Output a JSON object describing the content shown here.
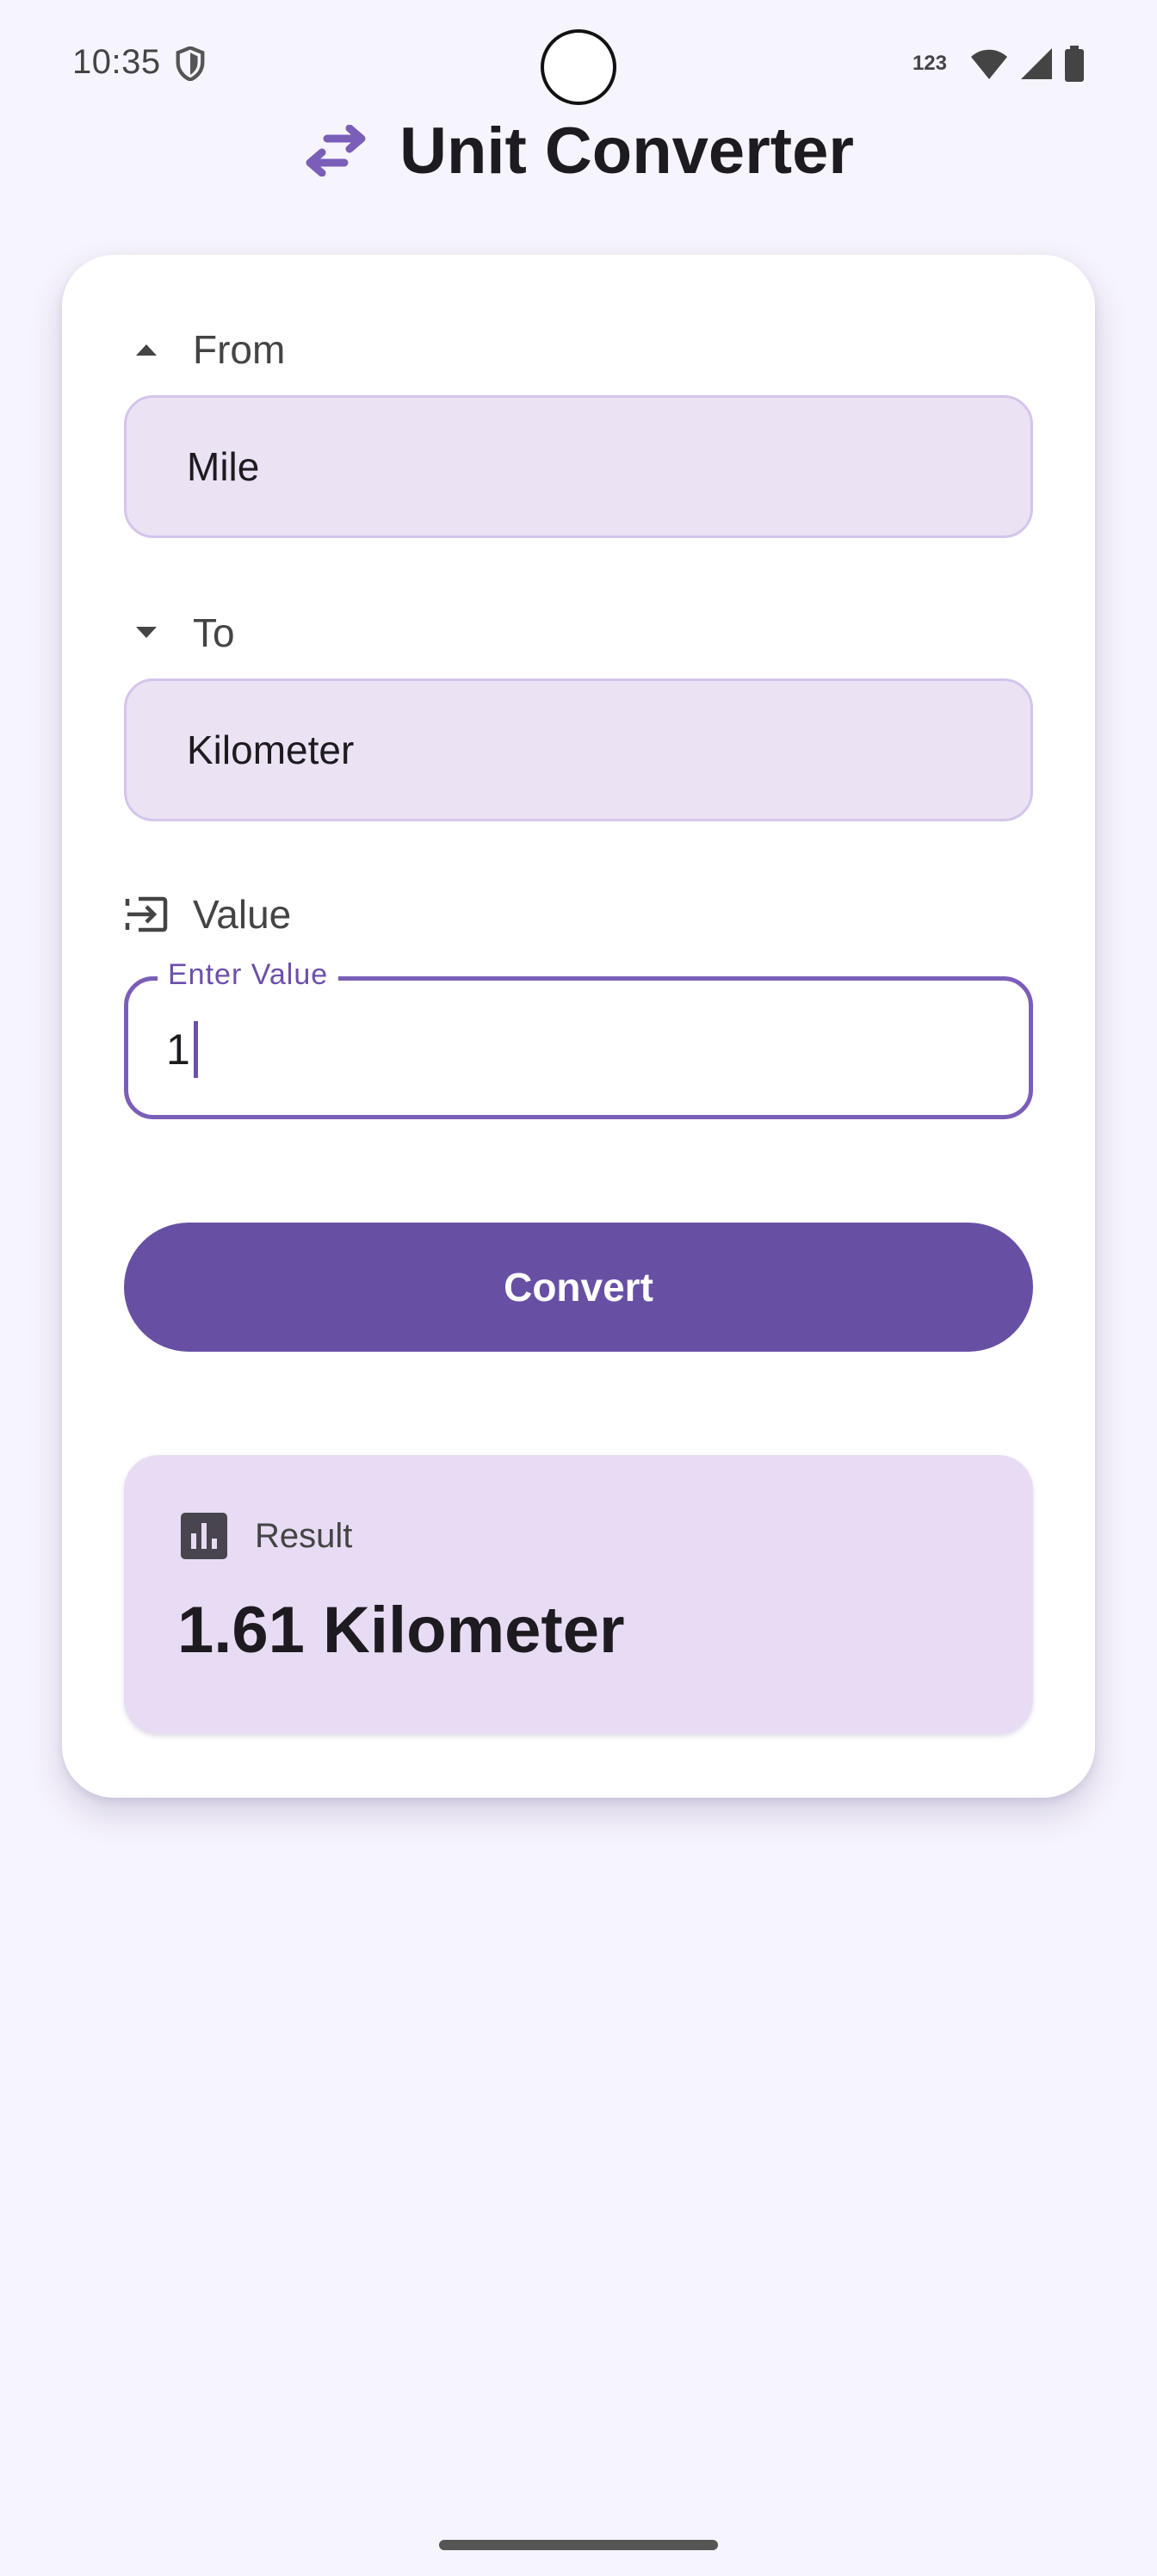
{
  "status_bar": {
    "time": "10:35",
    "keyboard_mode": "123"
  },
  "header": {
    "title": "Unit Converter",
    "icon": "swap-arrows-icon"
  },
  "from_section": {
    "label": "From",
    "icon": "arrow-up-icon",
    "selected": "Mile"
  },
  "to_section": {
    "label": "To",
    "icon": "arrow-down-icon",
    "selected": "Kilometer"
  },
  "value_section": {
    "label": "Value",
    "icon": "input-icon",
    "field_label": "Enter Value",
    "value": "1"
  },
  "convert_button": {
    "label": "Convert"
  },
  "result": {
    "label": "Result",
    "icon": "bar-chart-icon",
    "value": "1.61 Kilometer"
  },
  "colors": {
    "accent": "#6750a4",
    "field_fill": "#ebe2f3",
    "result_fill": "#e8dcf4",
    "background": "#f6f4fc"
  }
}
